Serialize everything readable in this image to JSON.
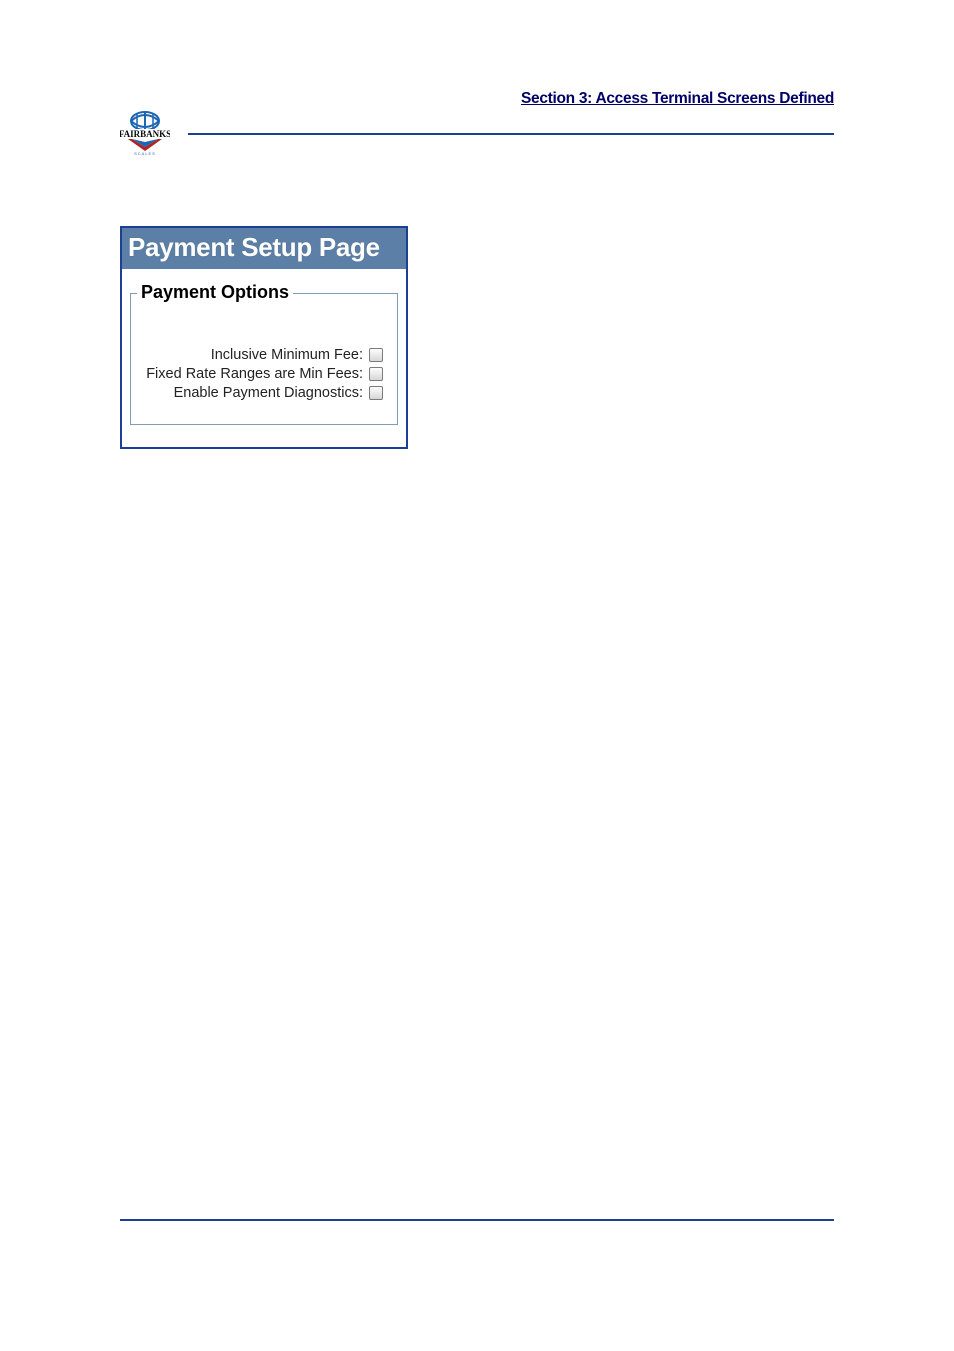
{
  "header": {
    "section_title": "Section 3:  Access Terminal Screens Defined",
    "logo_text": "FAIRBANKS",
    "logo_sub": "SCALES"
  },
  "panel": {
    "title": "Payment Setup Page",
    "fieldset_legend": "Payment Options",
    "options": {
      "inclusive_minimum_fee": "Inclusive Minimum Fee:",
      "fixed_rate_ranges": "Fixed Rate Ranges are Min Fees:",
      "enable_diagnostics": "Enable Payment Diagnostics:"
    },
    "option_checked": {
      "inclusive_minimum_fee": false,
      "fixed_rate_ranges": false,
      "enable_diagnostics": false
    }
  },
  "colors": {
    "brand_blue": "#1c3f94",
    "panel_header_bg": "#5b7fa6"
  }
}
